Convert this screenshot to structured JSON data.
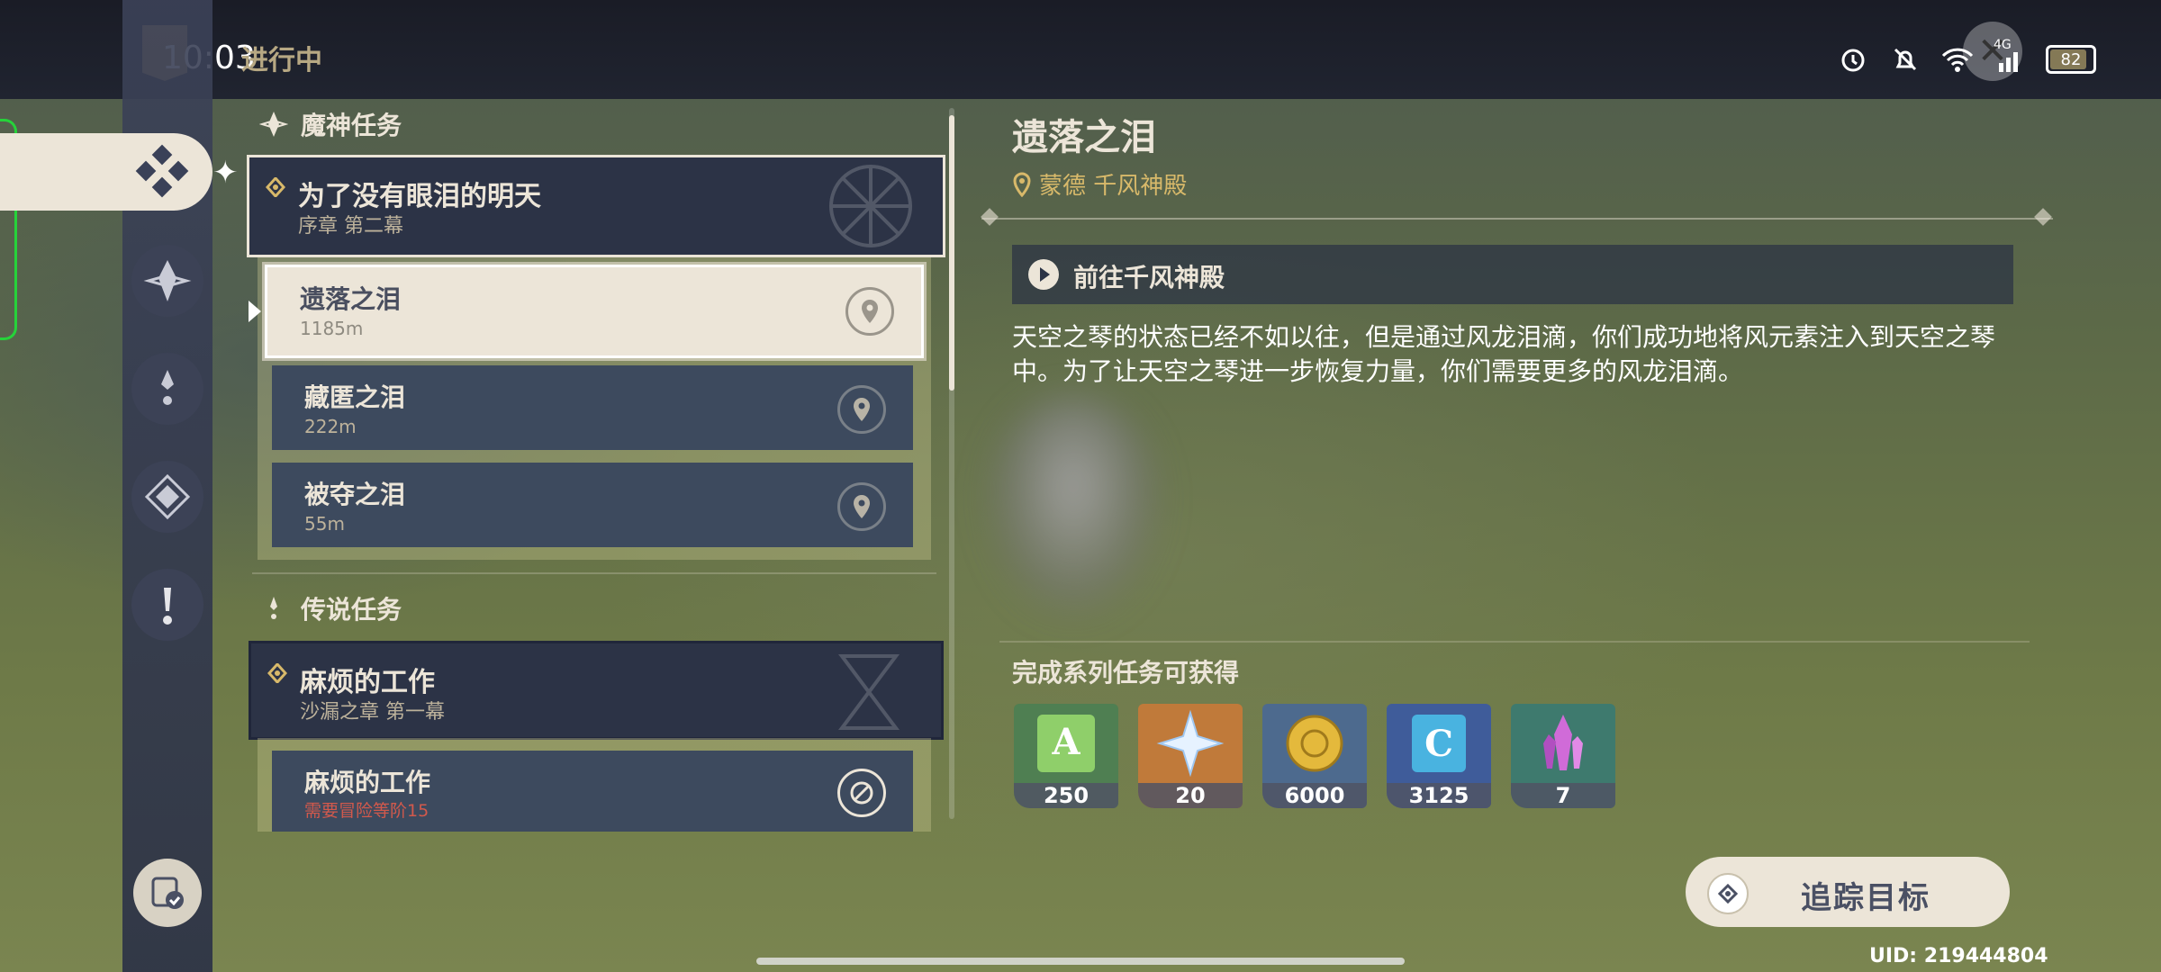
{
  "status_bar": {
    "time": "10:03",
    "network": "4G",
    "battery": "82"
  },
  "header": {
    "tab_title": "进行中"
  },
  "colors": {
    "accent_gold": "#d8b96a",
    "panel_dark": "#2c3346",
    "cream": "#ece5d8",
    "warning_red": "#d2594c"
  },
  "sections": [
    {
      "title": "魔神任务",
      "icon": "archon-quest-icon"
    },
    {
      "title": "传说任务",
      "icon": "story-quest-icon"
    }
  ],
  "archon_chain": {
    "title": "为了没有眼泪的明天",
    "subtitle": "序章 第二幕"
  },
  "archon_quests": [
    {
      "title": "遗落之泪",
      "distance": "1185m",
      "icon": "map-pin-icon"
    },
    {
      "title": "藏匿之泪",
      "distance": "222m",
      "icon": "map-pin-icon"
    },
    {
      "title": "被夺之泪",
      "distance": "55m",
      "icon": "map-pin-icon"
    }
  ],
  "story_chain": {
    "title": "麻烦的工作",
    "subtitle": "沙漏之章 第一幕"
  },
  "story_quests": [
    {
      "title": "麻烦的工作",
      "warning": "需要冒险等阶15",
      "icon": "locked-icon"
    }
  ],
  "detail": {
    "title": "遗落之泪",
    "location": "蒙德 千风神殿",
    "step": "前往千风神殿",
    "description": "天空之琴的状态已经不如以往，但是通过风龙泪滴，你们成功地将风元素注入到天空之琴中。为了让天空之琴进一步恢复力量，你们需要更多的风龙泪滴。",
    "rewards_title": "完成系列任务可获得",
    "rewards": [
      {
        "name": "adventure-exp-icon",
        "count": "250"
      },
      {
        "name": "primogem-icon",
        "count": "20"
      },
      {
        "name": "mora-icon",
        "count": "6000"
      },
      {
        "name": "companionship-exp-icon",
        "count": "3125"
      },
      {
        "name": "crystal-ore-icon",
        "count": "7"
      }
    ],
    "track_button": "追踪目标"
  },
  "uid": "UID: 219444804"
}
